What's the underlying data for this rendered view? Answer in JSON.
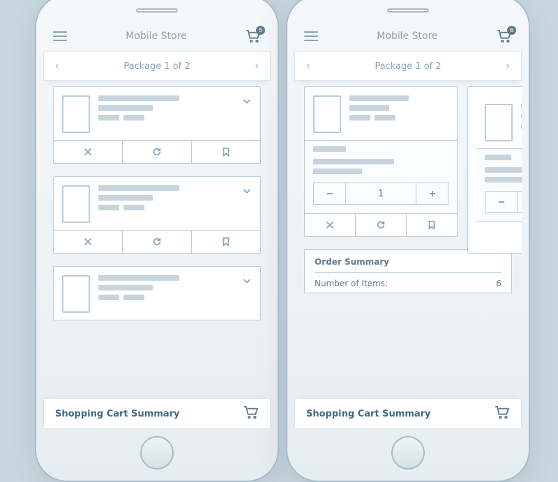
{
  "app_title": "Mobile Store",
  "cart_badge_left": "5",
  "cart_badge_right": "6",
  "package_label": "Package 1 of 2",
  "quantity": "1",
  "order_summary_title": "Order Summary",
  "order_summary_row_label": "Number of Items:",
  "order_summary_row_value": "6",
  "footer_label": "Shopping Cart Summary"
}
